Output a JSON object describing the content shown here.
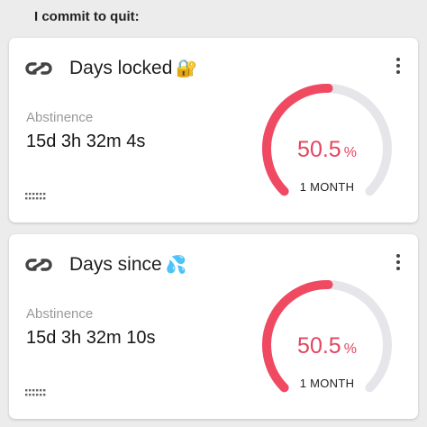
{
  "header": {
    "title": "I commit to quit:"
  },
  "colors": {
    "accent": "#f04a63",
    "track": "#e6e6ea",
    "background": "#ececec"
  },
  "cards": [
    {
      "icon": "infinity-link-icon",
      "title": "Days locked",
      "emoji": "🔐",
      "label": "Abstinence",
      "value": "15d 3h 32m 4s",
      "progress_percent": 50.5,
      "percent_text": "50.5",
      "percent_unit": "%",
      "period": "1 MONTH"
    },
    {
      "icon": "infinity-link-icon",
      "title": "Days since",
      "emoji": "💦",
      "label": "Abstinence",
      "value": "15d 3h 32m 10s",
      "progress_percent": 50.5,
      "percent_text": "50.5",
      "percent_unit": "%",
      "period": "1 MONTH"
    }
  ]
}
